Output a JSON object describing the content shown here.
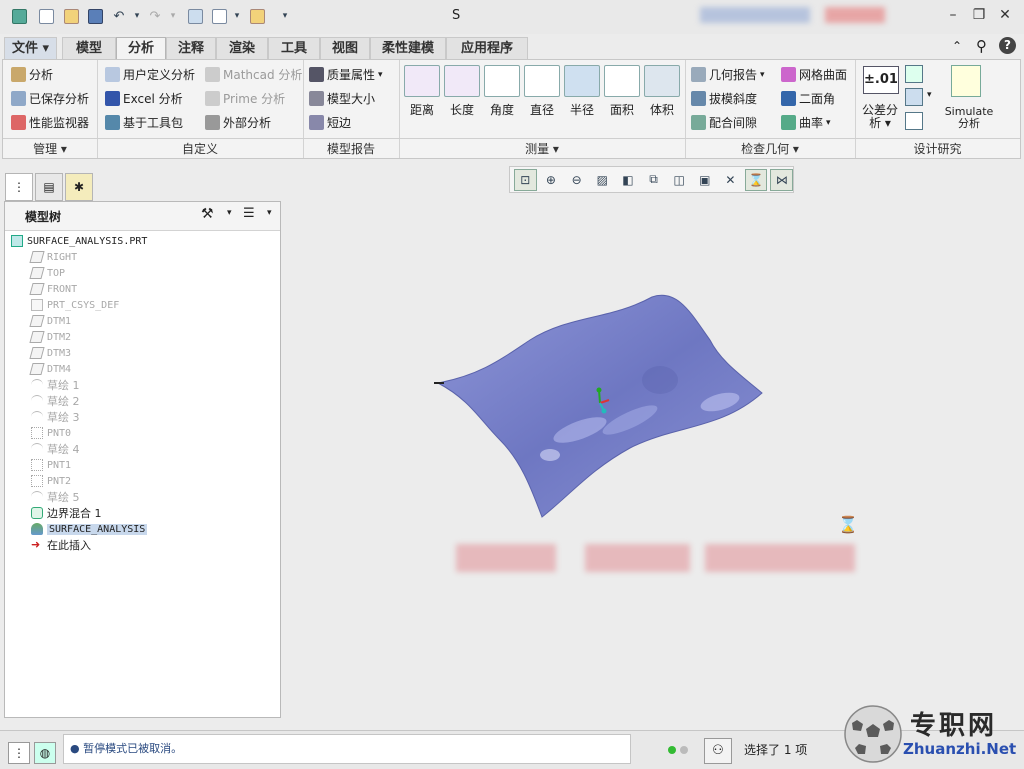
{
  "window": {
    "title": "S"
  },
  "tabs": [
    {
      "label": "文件",
      "active": false
    },
    {
      "label": "模型",
      "active": false
    },
    {
      "label": "分析",
      "active": true
    },
    {
      "label": "注释",
      "active": false
    },
    {
      "label": "渲染",
      "active": false
    },
    {
      "label": "工具",
      "active": false
    },
    {
      "label": "视图",
      "active": false
    },
    {
      "label": "柔性建模",
      "active": false
    },
    {
      "label": "应用程序",
      "active": false
    }
  ],
  "ribbon": {
    "manage": {
      "analysis": "分析",
      "saved_analysis": "已保存分析",
      "perf_monitor": "性能监视器"
    },
    "custom": {
      "user_defined": "用户定义分析",
      "excel": "Excel 分析",
      "toolkit": "基于工具包",
      "mathcad": "Mathcad 分析",
      "prime": "Prime 分析",
      "external": "外部分析"
    },
    "model_report": {
      "mass_props": "质量属性",
      "model_size": "模型大小",
      "short_edge": "短边"
    },
    "measure": {
      "distance": "距离",
      "length": "长度",
      "angle": "角度",
      "diameter": "直径",
      "radius": "半径",
      "area": "面积",
      "volume": "体积"
    },
    "inspect": {
      "geom_report": "几何报告",
      "draft": "拔模斜度",
      "clearance": "配合间隙",
      "mesh_surface": "网格曲面",
      "dihedral": "二面角",
      "curvature": "曲率"
    },
    "design_study": {
      "tolerance_top": "公差分",
      "tolerance_bottom": "析",
      "tolerance_value": "±.01",
      "simulate_top": "Simulate",
      "simulate_bottom": "分析"
    },
    "group_labels": {
      "manage": "管理",
      "custom": "自定义",
      "model_report": "模型报告",
      "measure": "测量",
      "inspect": "检查几何",
      "design_study": "设计研究"
    }
  },
  "tree": {
    "header": "模型树",
    "root": "SURFACE_ANALYSIS.PRT",
    "items": [
      {
        "label": "RIGHT",
        "dim": true,
        "type": "plane"
      },
      {
        "label": "TOP",
        "dim": true,
        "type": "plane"
      },
      {
        "label": "FRONT",
        "dim": true,
        "type": "plane"
      },
      {
        "label": "PRT_CSYS_DEF",
        "dim": true,
        "type": "csys"
      },
      {
        "label": "DTM1",
        "dim": true,
        "type": "plane"
      },
      {
        "label": "DTM2",
        "dim": true,
        "type": "plane"
      },
      {
        "label": "DTM3",
        "dim": true,
        "type": "plane"
      },
      {
        "label": "DTM4",
        "dim": true,
        "type": "plane"
      },
      {
        "label": "草绘 1",
        "dim": true,
        "type": "sketch"
      },
      {
        "label": "草绘 2",
        "dim": true,
        "type": "sketch"
      },
      {
        "label": "草绘 3",
        "dim": true,
        "type": "sketch"
      },
      {
        "label": "PNT0",
        "dim": true,
        "type": "point"
      },
      {
        "label": "草绘 4",
        "dim": true,
        "type": "sketch"
      },
      {
        "label": "PNT1",
        "dim": true,
        "type": "point"
      },
      {
        "label": "PNT2",
        "dim": true,
        "type": "point"
      },
      {
        "label": "草绘 5",
        "dim": true,
        "type": "sketch"
      },
      {
        "label": "边界混合 1",
        "dim": false,
        "type": "blend"
      },
      {
        "label": "SURFACE_ANALYSIS",
        "dim": false,
        "type": "analysis"
      },
      {
        "label": "在此插入",
        "dim": false,
        "type": "insert"
      }
    ]
  },
  "status": {
    "message": "● 暂停模式已被取消。",
    "selection": "选择了 1 项"
  },
  "watermark": {
    "cn": "专职网",
    "en": "Zhuanzhi.Net"
  },
  "colors": {
    "surface": "#7d86cc",
    "accent": "#2f6db5",
    "active_tab": "#f3f3f3"
  }
}
